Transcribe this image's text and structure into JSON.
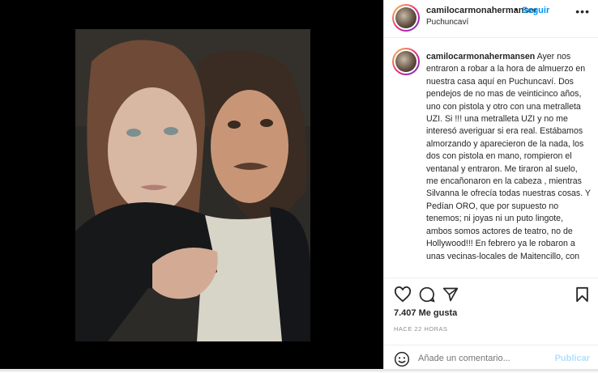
{
  "header": {
    "username": "camilocarmonahermanser",
    "separator": "•",
    "follow_label": "Seguir",
    "location": "Puchuncaví",
    "more_icon": "more-icon"
  },
  "caption": {
    "username": "camilocarmonahermansen",
    "text": "Ayer nos entraron a robar a la hora de almuerzo en nuestra casa aquí en Puchuncaví. Dos pendejos de no mas de veinticinco años, uno con pistola y otro con una metralleta UZI. Si !!! una metralleta UZI y no me interesó averiguar si era real. Estábamos almorzando y aparecieron de la nada, los dos con pistola en mano, rompieron el ventanal y entraron. Me tiraron al suelo, me encañonaron en la cabeza , mientras Silvanna le ofrecía todas nuestras cosas. Y Pedían ORO, que por supuesto no tenemos; ni joyas ni un puto lingote, ambos somos actores de teatro, no de Hollywood!!! En febrero ya le robaron a unas vecinas-locales de Maitencillo, con"
  },
  "actions": {
    "icons": [
      "heart-icon",
      "comment-icon",
      "share-icon",
      "bookmark-icon"
    ],
    "likes": "7.407 Me gusta",
    "time": "HACE 22 HORAS"
  },
  "comment_bar": {
    "placeholder": "Añade un comentario...",
    "publish_label": "Publicar",
    "emoji_icon": "emoji-icon"
  },
  "colors": {
    "link_blue": "#0095f6",
    "publish_disabled": "#b2dffc",
    "text": "#262626",
    "muted": "#8e8e8e"
  }
}
